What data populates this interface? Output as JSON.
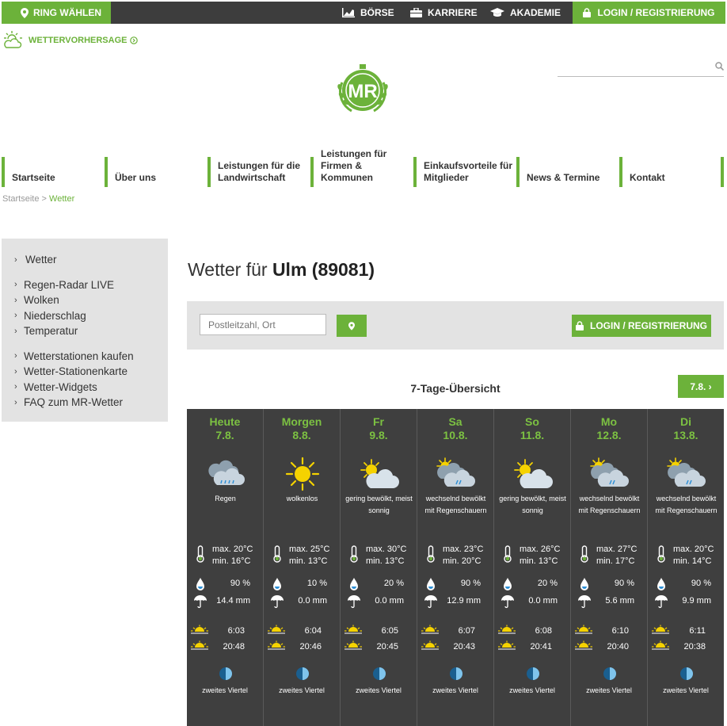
{
  "topbar": {
    "ring_label": "RING WÄHLEN",
    "boerse": "BÖRSE",
    "karriere": "KARRIERE",
    "akademie": "AKADEMIE",
    "login": "LOGIN / REGISTRIERUNG"
  },
  "wetter_link": "WETTERVORHERSAGE",
  "logo_text": "MR",
  "nav": [
    "Startseite",
    "Über uns",
    "Leistungen für die Landwirtschaft",
    "Leistungen für Firmen & Kommunen",
    "Einkaufsvorteile für Mitglieder",
    "News & Termine",
    "Kontakt"
  ],
  "breadcrumb": {
    "home": "Startseite",
    "sep": ">",
    "current": "Wetter"
  },
  "sidebar": {
    "group1": [
      "Wetter"
    ],
    "group2": [
      "Regen-Radar LIVE",
      "Wolken",
      "Niederschlag",
      "Temperatur"
    ],
    "group3": [
      "Wetterstationen kaufen",
      "Wetter-Stationenkarte",
      "Wetter-Widgets",
      "FAQ zum MR-Wetter"
    ]
  },
  "title": {
    "prefix": "Wetter für ",
    "city": "Ulm (89081)"
  },
  "search": {
    "placeholder": "Postleitzahl, Ort",
    "login": "LOGIN / REGISTRIERUNG"
  },
  "overview_title": "7-Tage-Übersicht",
  "next_label": "7.8. ›",
  "days": [
    {
      "name": "Heute",
      "date": "7.8.",
      "icon": "cloud-rain-icon",
      "desc": "Regen",
      "tmax": "max. 20°C",
      "tmin": "min. 16°C",
      "rain_prob": "90 %",
      "rain_mm": "14.4 mm",
      "sunrise": "6:03",
      "sunset": "20:48",
      "moon": "zweites Viertel"
    },
    {
      "name": "Morgen",
      "date": "8.8.",
      "icon": "sun-icon",
      "desc": "wolkenlos",
      "tmax": "max. 25°C",
      "tmin": "min. 13°C",
      "rain_prob": "10 %",
      "rain_mm": "0.0 mm",
      "sunrise": "6:04",
      "sunset": "20:46",
      "moon": "zweites Viertel"
    },
    {
      "name": "Fr",
      "date": "9.8.",
      "icon": "sun-cloud-icon",
      "desc": "gering bewölkt, meist sonnig",
      "tmax": "max. 30°C",
      "tmin": "min. 13°C",
      "rain_prob": "20 %",
      "rain_mm": "0.0 mm",
      "sunrise": "6:05",
      "sunset": "20:45",
      "moon": "zweites Viertel"
    },
    {
      "name": "Sa",
      "date": "10.8.",
      "icon": "sun-cloud-rain-icon",
      "desc": "wechselnd bewölkt mit Regenschauern",
      "tmax": "max. 23°C",
      "tmin": "min. 20°C",
      "rain_prob": "90 %",
      "rain_mm": "12.9 mm",
      "sunrise": "6:07",
      "sunset": "20:43",
      "moon": "zweites Viertel"
    },
    {
      "name": "So",
      "date": "11.8.",
      "icon": "sun-cloud-icon",
      "desc": "gering bewölkt, meist sonnig",
      "tmax": "max. 26°C",
      "tmin": "min. 13°C",
      "rain_prob": "20 %",
      "rain_mm": "0.0 mm",
      "sunrise": "6:08",
      "sunset": "20:41",
      "moon": "zweites Viertel"
    },
    {
      "name": "Mo",
      "date": "12.8.",
      "icon": "sun-cloud-rain-icon",
      "desc": "wechselnd bewölkt mit Regenschauern",
      "tmax": "max. 27°C",
      "tmin": "min. 17°C",
      "rain_prob": "90 %",
      "rain_mm": "5.6 mm",
      "sunrise": "6:10",
      "sunset": "20:40",
      "moon": "zweites Viertel"
    },
    {
      "name": "Di",
      "date": "13.8.",
      "icon": "sun-cloud-rain-icon",
      "desc": "wechselnd bewölkt mit Regenschauern",
      "tmax": "max. 20°C",
      "tmin": "min. 14°C",
      "rain_prob": "90 %",
      "rain_mm": "9.9 mm",
      "sunrise": "6:11",
      "sunset": "20:38",
      "moon": "zweites Viertel"
    }
  ],
  "colors": {
    "accent": "#6cb23a",
    "topbar": "#3d3d3d",
    "forecast_bg": "#3f3f3f",
    "day_label": "#7cc142"
  }
}
